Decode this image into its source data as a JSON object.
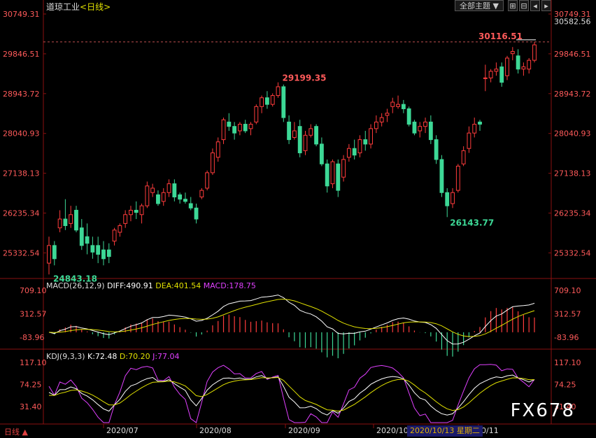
{
  "title": {
    "name": "道琼工业",
    "period": "<日线>"
  },
  "toolbar": {
    "theme_label": "全部主题",
    "icons": [
      "zoom-in-icon",
      "zoom-out-icon",
      "scroll-left-icon",
      "scroll-right-icon"
    ]
  },
  "colors": {
    "up": "#ff3c3c",
    "down": "#3dd896",
    "bg": "#000000",
    "axis": "#8a1010",
    "price_label": "#ff5a5a",
    "ma1": "#ffffff",
    "ma2": "#e0e000",
    "ma3": "#e040ff"
  },
  "price_axis": [
    "30749.31",
    "29846.51",
    "28943.72",
    "28040.93",
    "27138.13",
    "26235.34",
    "25332.54"
  ],
  "price_right_extra": "30582.56",
  "annotations": {
    "high": "30116.51",
    "peak_sep": "29199.35",
    "low_jun": "24843.18",
    "low_oct": "26143.77"
  },
  "macd": {
    "label": "MACD(26,12,9)",
    "diff": "DIFF:490.91",
    "dea": "DEA:401.54",
    "macd": "MACD:178.75",
    "axis": [
      "709.10",
      "312.57",
      "-83.96"
    ]
  },
  "kdj": {
    "label": "KDJ(9,3,3)",
    "k": "K:72.48",
    "d": "D:70.20",
    "j": "J:77.04",
    "axis": [
      "117.10",
      "74.25",
      "31.40"
    ]
  },
  "x_labels": [
    "2020/07",
    "2020/08",
    "2020/09",
    "2020/10",
    "0/11"
  ],
  "footer": {
    "period": "日线 ▲",
    "cursor_date": "2020/10/13 星期二"
  },
  "watermark": "FX678",
  "chart_data": {
    "type": "candlestick",
    "ylim": [
      24800,
      30749.31
    ],
    "candles": [
      [
        25100,
        25700,
        24843.18,
        25500
      ],
      [
        25500,
        25600,
        25050,
        25200
      ],
      [
        25900,
        26300,
        25800,
        26100
      ],
      [
        26100,
        26550,
        25850,
        25950
      ],
      [
        26000,
        26400,
        25900,
        26200
      ],
      [
        26300,
        26400,
        25800,
        25850
      ],
      [
        25900,
        26100,
        25400,
        25500
      ],
      [
        25700,
        26000,
        25300,
        25550
      ],
      [
        25500,
        25700,
        25200,
        25350
      ],
      [
        25500,
        25700,
        25100,
        25300
      ],
      [
        25400,
        25600,
        25050,
        25200
      ],
      [
        25400,
        25550,
        25100,
        25250
      ],
      [
        25600,
        25900,
        25500,
        25850
      ],
      [
        25800,
        26000,
        25700,
        25950
      ],
      [
        26000,
        26300,
        25900,
        26200
      ],
      [
        26200,
        26400,
        26050,
        26300
      ],
      [
        26300,
        26500,
        26100,
        26250
      ],
      [
        26200,
        26450,
        26000,
        26400
      ],
      [
        26400,
        26950,
        26350,
        26850
      ],
      [
        26700,
        26900,
        26600,
        26800
      ],
      [
        26650,
        26750,
        26400,
        26450
      ],
      [
        26500,
        26800,
        26400,
        26700
      ],
      [
        26700,
        27000,
        26600,
        26900
      ],
      [
        26900,
        27000,
        26500,
        26600
      ],
      [
        26650,
        26700,
        26450,
        26550
      ],
      [
        26550,
        26700,
        26450,
        26500
      ],
      [
        26450,
        26600,
        26300,
        26350
      ],
      [
        26350,
        26450,
        26000,
        26100
      ],
      [
        26600,
        26800,
        26550,
        26750
      ],
      [
        26800,
        27200,
        26750,
        27150
      ],
      [
        27150,
        27700,
        27100,
        27600
      ],
      [
        27500,
        27950,
        27400,
        27850
      ],
      [
        27900,
        28400,
        27800,
        28350
      ],
      [
        28300,
        28500,
        28100,
        28200
      ],
      [
        28200,
        28300,
        27900,
        28050
      ],
      [
        28100,
        28300,
        28000,
        28250
      ],
      [
        28250,
        28350,
        28050,
        28100
      ],
      [
        28150,
        28300,
        28000,
        28250
      ],
      [
        28300,
        28700,
        28250,
        28650
      ],
      [
        28650,
        28900,
        28500,
        28850
      ],
      [
        28850,
        29000,
        28600,
        28700
      ],
      [
        28700,
        28950,
        28650,
        28900
      ],
      [
        28900,
        29199.35,
        28850,
        29100
      ],
      [
        29100,
        29150,
        28300,
        28400
      ],
      [
        28300,
        28450,
        27800,
        27900
      ],
      [
        27950,
        28300,
        27900,
        28100
      ],
      [
        28200,
        28350,
        27500,
        27600
      ],
      [
        27650,
        28100,
        27550,
        28000
      ],
      [
        28000,
        28250,
        27950,
        28150
      ],
      [
        28200,
        28250,
        27750,
        27800
      ],
      [
        27800,
        27950,
        27300,
        27350
      ],
      [
        27350,
        27450,
        26700,
        26850
      ],
      [
        26900,
        27450,
        26800,
        27400
      ],
      [
        27350,
        27450,
        26600,
        26750
      ],
      [
        27050,
        27550,
        26950,
        27450
      ],
      [
        27500,
        27800,
        27400,
        27700
      ],
      [
        27700,
        27900,
        27450,
        27550
      ],
      [
        27600,
        28000,
        27500,
        27900
      ],
      [
        27900,
        28100,
        27650,
        27800
      ],
      [
        27800,
        28250,
        27700,
        28150
      ],
      [
        28150,
        28450,
        28050,
        28300
      ],
      [
        28300,
        28500,
        28200,
        28400
      ],
      [
        28450,
        28600,
        28300,
        28500
      ],
      [
        28650,
        28850,
        28500,
        28750
      ],
      [
        28650,
        28900,
        28600,
        28700
      ],
      [
        28700,
        28800,
        28500,
        28600
      ],
      [
        28600,
        28650,
        28200,
        28250
      ],
      [
        28300,
        28350,
        28000,
        28050
      ],
      [
        28100,
        28300,
        27950,
        28200
      ],
      [
        28200,
        28400,
        28050,
        28300
      ],
      [
        28300,
        28450,
        27800,
        27900
      ],
      [
        27900,
        28000,
        27350,
        27450
      ],
      [
        27450,
        27550,
        26600,
        26700
      ],
      [
        26700,
        26800,
        26143.77,
        26400
      ],
      [
        26450,
        26800,
        26350,
        26700
      ],
      [
        26750,
        27350,
        26700,
        27300
      ],
      [
        27350,
        27750,
        27300,
        27650
      ],
      [
        27700,
        28200,
        27600,
        28050
      ],
      [
        28050,
        28400,
        27950,
        28250
      ],
      [
        28300,
        28350,
        28100,
        28250
      ],
      [
        29300,
        29600,
        29000,
        29300
      ],
      [
        29300,
        29500,
        29200,
        29450
      ],
      [
        29450,
        29650,
        29350,
        29500
      ],
      [
        29550,
        29650,
        29100,
        29200
      ],
      [
        29350,
        29800,
        29250,
        29750
      ],
      [
        29850,
        30000,
        29700,
        29900
      ],
      [
        29800,
        29950,
        29400,
        29500
      ],
      [
        29500,
        29650,
        29350,
        29550
      ],
      [
        29500,
        29750,
        29400,
        29700
      ],
      [
        29700,
        30116.51,
        29650,
        30050
      ]
    ],
    "macd_series": {
      "diff_end": 490.91,
      "dea_end": 401.54,
      "macd_end": 178.75,
      "ylim": [
        -250,
        709.1
      ]
    },
    "kdj_series": {
      "k_end": 72.48,
      "d_end": 70.2,
      "j_end": 77.04,
      "ylim": [
        0,
        117.1
      ]
    }
  }
}
